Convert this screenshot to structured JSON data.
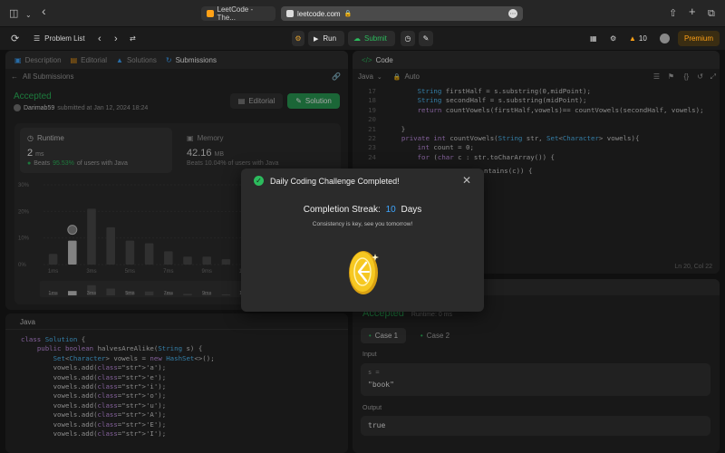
{
  "browser": {
    "tab_title": "LeetCode - The...",
    "url": "leetcode.com"
  },
  "toolbar": {
    "problem_list": "Problem List",
    "run": "Run",
    "submit": "Submit",
    "streak_count": "10",
    "premium": "Premium"
  },
  "left_panel": {
    "tabs": [
      {
        "label": "Description",
        "icon": "description-icon"
      },
      {
        "label": "Editorial",
        "icon": "editorial-icon"
      },
      {
        "label": "Solutions",
        "icon": "solutions-icon"
      },
      {
        "label": "Submissions",
        "icon": "submissions-icon"
      }
    ],
    "back_label": "All Submissions",
    "status": "Accepted",
    "username": "Darimab59",
    "submitted_text": "submitted at Jan 12, 2024 18:24",
    "editorial_button": "Editorial",
    "solution_button": "Solution",
    "runtime": {
      "label": "Runtime",
      "value": "2",
      "unit": "ms",
      "beats_prefix": "Beats",
      "beats_pct": "95.53%",
      "beats_suffix": "of users with Java"
    },
    "memory": {
      "label": "Memory",
      "value": "42.16",
      "unit": "MB",
      "beats_text": "Beats 10.04% of users with Java"
    },
    "language_label": "Java",
    "code": [
      "class Solution {",
      "    public boolean halvesAreAlike(String s) {",
      "        Set<Character> vowels = new HashSet<>();",
      "        vowels.add('a');",
      "        vowels.add('e');",
      "        vowels.add('i');",
      "        vowels.add('o');",
      "        vowels.add('u');",
      "        vowels.add('A');",
      "        vowels.add('E');",
      "        vowels.add('I');"
    ]
  },
  "chart_data": {
    "type": "bar",
    "ylabel_ticks": [
      "30%",
      "20%",
      "10%",
      "0%"
    ],
    "ylim": [
      0,
      30
    ],
    "categories": [
      "1ms",
      "2ms",
      "3ms",
      "4ms",
      "5ms",
      "6ms",
      "7ms",
      "8ms",
      "9ms",
      "10ms",
      "11ms",
      "12ms",
      "13ms",
      "14ms",
      "15ms"
    ],
    "x_tick_labels": [
      "1ms",
      "3ms",
      "5ms",
      "7ms",
      "9ms",
      "11ms",
      "13ms"
    ],
    "values": [
      4,
      9,
      21,
      14,
      9,
      8,
      5,
      3,
      3,
      2,
      2,
      1,
      1,
      1,
      1
    ],
    "highlight_index": 1,
    "highlight_color": "#c8c8c8",
    "bar_color": "#4a4a4a",
    "overview_x_tick_labels": [
      "1ms",
      "3ms",
      "5ms",
      "7ms",
      "9ms",
      "11ms"
    ]
  },
  "code_panel": {
    "title": "Code",
    "language": "Java",
    "auto": "Auto",
    "line_numbers": [
      "17",
      "18",
      "19",
      "20",
      "21",
      "22",
      "23",
      "24"
    ],
    "code": [
      "        String firstHalf = s.substring(0,midPoint);",
      "        String secondHalf = s.substring(midPoint);",
      "        return countVowels(firstHalf,vowels)== countVowels(secondHalf, vowels);",
      "",
      "    }",
      "    private int countVowels(String str, Set<Character> vowels){",
      "        int count = 0;",
      "        for (char c : str.toCharArray()) {"
    ],
    "hidden_code_fragment": "ntains(c)) {",
    "cursor_pos": "Ln 20, Col 22"
  },
  "result_panel": {
    "status": "Accepted",
    "runtime": "Runtime: 0 ms",
    "case1": "Case 1",
    "case2": "Case 2",
    "input_label": "Input",
    "input_var": "s =",
    "input_value": "\"book\"",
    "output_label": "Output",
    "output_value": "true"
  },
  "modal": {
    "title": "Daily Coding Challenge Completed!",
    "streak_label": "Completion Streak:",
    "streak_value": "10",
    "streak_unit": "Days",
    "message": "Consistency is key, see you tomorrow!"
  },
  "colors": {
    "accent_green": "#2cbb5d",
    "accent_orange": "#ffa116",
    "blue": "#3ea6ff",
    "gold": "#f0c419"
  }
}
